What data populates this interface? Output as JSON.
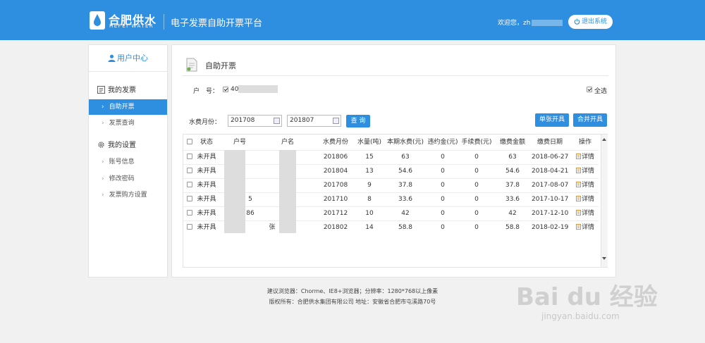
{
  "header": {
    "logo_cn": "合肥供水",
    "logo_en": "HEFEI WATER",
    "platform": "电子发票自助开票平台",
    "welcome": "欢迎您，zh",
    "logout_label": "退出系统"
  },
  "sidebar": {
    "title": "用户中心",
    "group1": "我的发票",
    "items1": [
      "自助开票",
      "发票查询"
    ],
    "group2": "我的设置",
    "items2": [
      "账号信息",
      "修改密码",
      "发票购方设置"
    ]
  },
  "main": {
    "title": "自助开票",
    "account_label": "户　号：",
    "account_prefix": "40",
    "select_all": "全选",
    "month_label": "水费月份：",
    "month_from": "201708",
    "month_to": "201807",
    "query_btn": "查 询",
    "single_btn": "单张开具",
    "merge_btn": "合并开具"
  },
  "table": {
    "headers": [
      "状态",
      "户号",
      "户名",
      "水费月份",
      "水量(吨)",
      "本期水费(元)",
      "违约金(元)",
      "手续费(元)",
      "缴费金额",
      "缴费日期",
      "操作"
    ],
    "action_label": "详情",
    "rows": [
      {
        "status": "未开具",
        "acct": "",
        "name": "",
        "month": "201806",
        "qty": "15",
        "fee": "63",
        "penalty": "0",
        "charge": "0",
        "amount": "63",
        "date": "2018-06-27"
      },
      {
        "status": "未开具",
        "acct": "",
        "name": "",
        "month": "201804",
        "qty": "13",
        "fee": "54.6",
        "penalty": "0",
        "charge": "0",
        "amount": "54.6",
        "date": "2018-04-21"
      },
      {
        "status": "未开具",
        "acct": "",
        "name": "",
        "month": "201708",
        "qty": "9",
        "fee": "37.8",
        "penalty": "0",
        "charge": "0",
        "amount": "37.8",
        "date": "2017-08-07"
      },
      {
        "status": "未开具",
        "acct": "5",
        "name": "",
        "month": "201710",
        "qty": "8",
        "fee": "33.6",
        "penalty": "0",
        "charge": "0",
        "amount": "33.6",
        "date": "2017-10-17"
      },
      {
        "status": "未开具",
        "acct": "86",
        "name": "",
        "month": "201712",
        "qty": "10",
        "fee": "42",
        "penalty": "0",
        "charge": "0",
        "amount": "42",
        "date": "2017-12-10"
      },
      {
        "status": "未开具",
        "acct": "",
        "name": "张",
        "month": "201802",
        "qty": "14",
        "fee": "58.8",
        "penalty": "0",
        "charge": "0",
        "amount": "58.8",
        "date": "2018-02-19"
      }
    ]
  },
  "footer": {
    "line1": "建议浏览器：Chorme、IE8+浏览器；分辨率：1280*768以上像素",
    "line2": "版权所有：合肥供水集团有限公司 地址：安徽省合肥市屯溪路70号"
  },
  "watermark": {
    "brand": "Bai du 经验",
    "site": "jingyan.baidu.com"
  },
  "colors": {
    "primary": "#2e8fe1",
    "accent": "#e38d2b"
  }
}
